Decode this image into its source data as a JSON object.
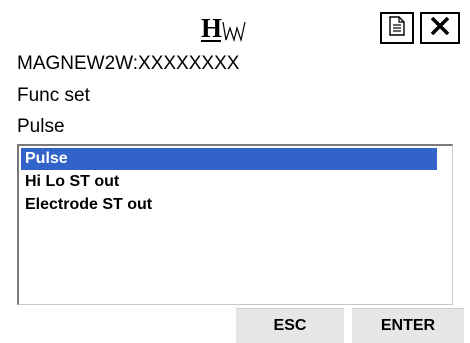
{
  "header": {
    "logo_icon": "hw-logo-icon",
    "doc_icon": "document-icon",
    "close_icon": "close-icon"
  },
  "device_id": "MAGNEW2W:XXXXXXXX",
  "menu_title": "Func set",
  "current_value": "Pulse",
  "list": {
    "items": [
      "Pulse",
      "Hi Lo ST out",
      "Electrode ST out"
    ],
    "selected": "Pulse"
  },
  "softkeys": {
    "esc_label": "ESC",
    "enter_label": "ENTER"
  },
  "colors": {
    "selection": "#3163c9",
    "softkey_bg": "#e6e6e6"
  }
}
